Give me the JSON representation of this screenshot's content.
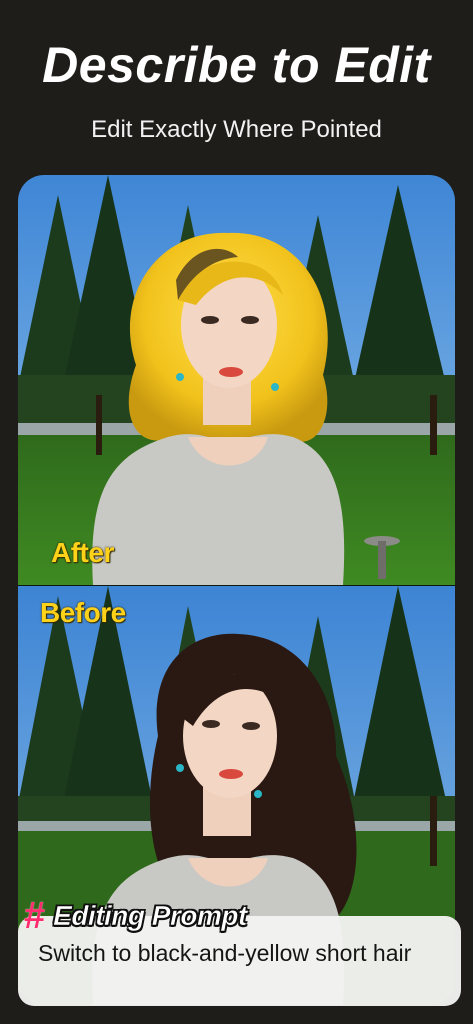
{
  "header": {
    "title": "Describe to Edit",
    "subtitle": "Edit Exactly Where Pointed"
  },
  "comparison": {
    "after_label": "After",
    "before_label": "Before",
    "after_hair": "short yellow bob",
    "before_hair": "long dark wavy"
  },
  "prompt": {
    "icon": "hash-icon",
    "title": "Editing Prompt",
    "text": "Switch to black-and-yellow short hair"
  },
  "colors": {
    "background": "#1f1d1a",
    "label_yellow": "#ffd21a",
    "hash_pink": "#ff2d6f",
    "card": "#f2f2f0"
  }
}
